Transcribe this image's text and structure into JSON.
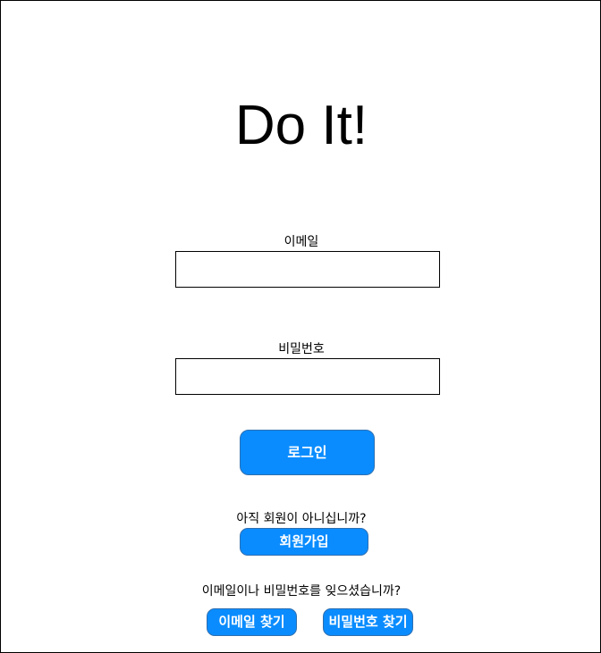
{
  "app": {
    "title": "Do It!"
  },
  "login_form": {
    "email_label": "이메일",
    "email_value": "",
    "password_label": "비밀번호",
    "password_value": "",
    "login_button_label": "로그인"
  },
  "signup": {
    "prompt": "아직 회원이 아니십니까?",
    "button_label": "회원가입"
  },
  "recovery": {
    "prompt": "이메일이나 비밀번호를 잊으셨습니까?",
    "find_email_label": "이메일 찾기",
    "find_password_label": "비밀번호 찾기"
  },
  "colors": {
    "button_background": "#0a8cff",
    "button_border": "#2f6fb0",
    "button_text": "#ffffff",
    "field_border": "#000000"
  }
}
